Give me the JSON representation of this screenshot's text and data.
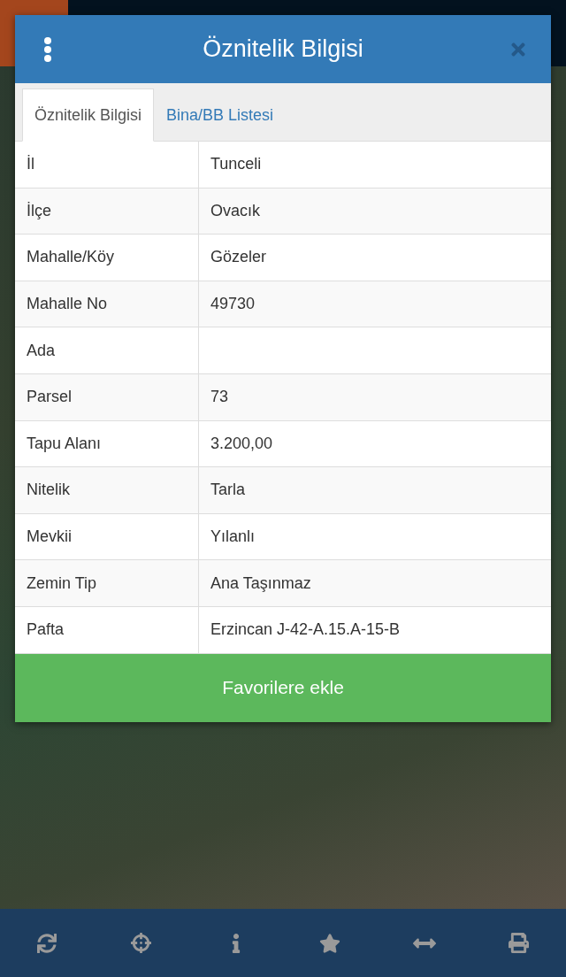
{
  "dialog": {
    "title": "Öznitelik Bilgisi"
  },
  "tabs": [
    {
      "label": "Öznitelik Bilgisi",
      "selected": true
    },
    {
      "label": "Bina/BB Listesi",
      "selected": false
    }
  ],
  "rows": [
    {
      "label": "İl",
      "value": "Tunceli"
    },
    {
      "label": "İlçe",
      "value": "Ovacık"
    },
    {
      "label": "Mahalle/Köy",
      "value": "Gözeler"
    },
    {
      "label": "Mahalle No",
      "value": "49730"
    },
    {
      "label": "Ada"
    },
    {
      "label": "Parsel",
      "value": "73"
    },
    {
      "label": "Tapu Alanı",
      "value": "3.200,00"
    },
    {
      "label": "Nitelik",
      "value": "Tarla"
    },
    {
      "label": "Mevkii",
      "value": "Yılanlı"
    },
    {
      "label": "Zemin Tip",
      "value": "Ana Taşınmaz"
    },
    {
      "label": "Pafta",
      "value": "Erzincan J-42-A.15.A-15-B"
    }
  ],
  "action_button": {
    "label": "Favorilere ekle"
  },
  "bottom_toolbar": [
    {
      "kind": "refresh"
    },
    {
      "kind": "locate"
    },
    {
      "kind": "info"
    },
    {
      "kind": "star"
    },
    {
      "kind": "measure"
    },
    {
      "kind": "print"
    }
  ]
}
